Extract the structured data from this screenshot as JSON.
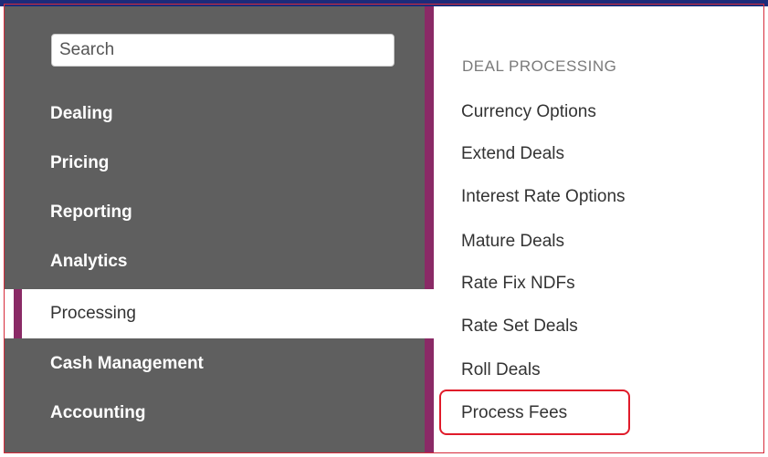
{
  "search": {
    "placeholder": "Search"
  },
  "sidebar": {
    "items": [
      {
        "label": "Dealing"
      },
      {
        "label": "Pricing"
      },
      {
        "label": "Reporting"
      },
      {
        "label": "Analytics"
      },
      {
        "label": "Processing",
        "active": true
      },
      {
        "label": "Cash Management"
      },
      {
        "label": "Accounting"
      }
    ]
  },
  "submenu": {
    "section_title": "DEAL PROCESSING",
    "items": [
      {
        "label": "Currency Options"
      },
      {
        "label": "Extend Deals"
      },
      {
        "label": "Interest Rate Options"
      },
      {
        "label": "Mature Deals"
      },
      {
        "label": "Rate Fix NDFs"
      },
      {
        "label": "Rate Set Deals"
      },
      {
        "label": "Roll Deals"
      },
      {
        "label": "Process Fees",
        "highlighted": true
      }
    ]
  },
  "colors": {
    "sidebar_bg": "#5f5f5f",
    "accent": "#8a2a66",
    "highlight_border": "#e01b2a",
    "top_bar": "#1d2b7a"
  }
}
